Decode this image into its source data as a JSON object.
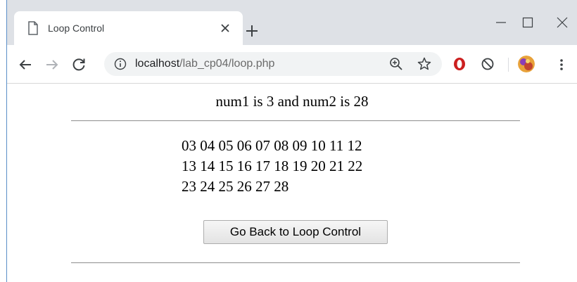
{
  "tab": {
    "title": "Loop Control",
    "page_icon": "page-icon",
    "close_icon": "close-icon"
  },
  "newtab_icon": "plus-icon",
  "window_controls": {
    "minimize_icon": "minimize-icon",
    "maximize_icon": "maximize-icon",
    "close_icon": "close-icon"
  },
  "toolbar": {
    "back_icon": "arrow-left-icon",
    "forward_icon": "arrow-right-icon",
    "reload_icon": "reload-icon",
    "url_host": "localhost",
    "url_path": "/lab_cp04/loop.php",
    "info_icon": "info-icon",
    "zoom_icon": "zoom-icon",
    "star_icon": "star-icon",
    "extensions": [
      "opera-icon",
      "block-icon"
    ],
    "avatar": "avatar",
    "menu_icon": "more-vert-icon"
  },
  "page": {
    "heading": "num1 is 3 and num2 is 28",
    "number_lines": [
      "03 04 05 06 07 08 09 10 11 12",
      "13 14 15 16 17 18 19 20 21 22",
      "23 24 25 26 27 28"
    ],
    "button_label": "Go Back to Loop Control"
  },
  "colors": {
    "tabstrip": "#dee1e6",
    "omnibox": "#f1f3f4",
    "opera_red": "#cc1f1f"
  }
}
